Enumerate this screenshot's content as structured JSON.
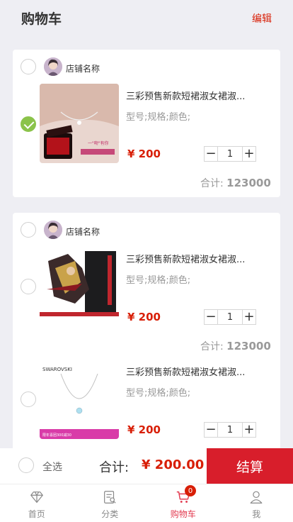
{
  "header": {
    "title": "购物车",
    "edit_label": "编辑"
  },
  "colors": {
    "accent": "#d81e06",
    "checked": "#8bc34a",
    "background": "#eeeef3",
    "checkout": "#d81e2b"
  },
  "shops": [
    {
      "shop_name": "店铺名称",
      "selected": false,
      "items": [
        {
          "title": "三彩预售新款短裙淑女裙淑...",
          "spec": "型号;规格;颜色;",
          "price": "¥ 200",
          "quantity": "1",
          "selected": true,
          "image_icon": "necklace-photo"
        }
      ],
      "subtotal_label": "合计:",
      "subtotal_value": "123000"
    },
    {
      "shop_name": "店铺名称",
      "selected": false,
      "items": [
        {
          "title": "三彩预售新款短裙淑女裙淑...",
          "spec": "型号;规格;颜色;",
          "price": "¥ 200",
          "quantity": "1",
          "selected": false,
          "image_icon": "gaming-pc-photo"
        },
        {
          "title": "三彩预售新款短裙淑女裙淑...",
          "spec": "型号;规格;颜色;",
          "price": "¥ 200",
          "quantity": "1",
          "selected": false,
          "image_icon": "swarovski-necklace-photo"
        }
      ],
      "subtotal_label": "合计:",
      "subtotal_value": "123000"
    }
  ],
  "stepper": {
    "minus": "−",
    "plus": "+"
  },
  "checkout": {
    "select_all_label": "全选",
    "total_label": "合计:",
    "total_value": "¥ 200.00",
    "pay_label": "结算"
  },
  "tabbar": [
    {
      "label": "首页",
      "icon": "diamond-icon",
      "active": false
    },
    {
      "label": "分类",
      "icon": "list-icon",
      "active": false
    },
    {
      "label": "购物车",
      "icon": "cart-icon",
      "active": true,
      "badge": "0"
    },
    {
      "label": "我",
      "icon": "user-icon",
      "active": false
    }
  ]
}
